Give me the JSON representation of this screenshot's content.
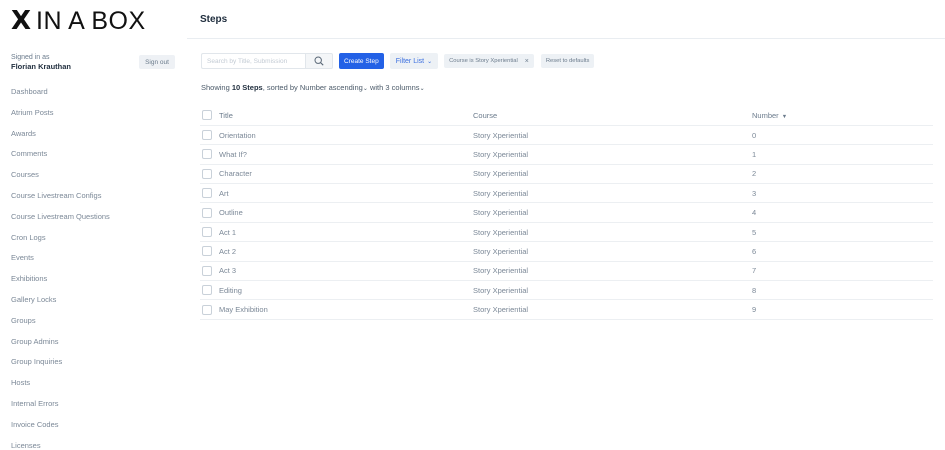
{
  "brand": {
    "mark": "X",
    "text": "IN A BOX"
  },
  "page": {
    "title": "Steps"
  },
  "user": {
    "signed_in_label": "Signed in as",
    "name": "Florian Krauthan",
    "sign_out_label": "Sign out"
  },
  "sidebar": {
    "items": [
      "Dashboard",
      "Atrium Posts",
      "Awards",
      "Comments",
      "Courses",
      "Course Livestream Configs",
      "Course Livestream Questions",
      "Cron Logs",
      "Events",
      "Exhibitions",
      "Gallery Locks",
      "Groups",
      "Group Admins",
      "Group Inquiries",
      "Hosts",
      "Internal Errors",
      "Invoice Codes",
      "Licenses"
    ]
  },
  "toolbar": {
    "search_placeholder": "Search by Title, Submission",
    "search_value": "",
    "create_label": "Create Step",
    "filter_label": "Filter List",
    "active_filter": "Course is Story Xperiential",
    "reset_label": "Reset to defaults"
  },
  "summary": {
    "prefix": "Showing",
    "count_text": "10 Steps",
    "sorted_text": ", sorted by",
    "sort_field": "Number ascending",
    "with_text": "with",
    "columns_text": "3 columns"
  },
  "table": {
    "headers": {
      "title": "Title",
      "course": "Course",
      "number": "Number"
    },
    "rows": [
      {
        "title": "Orientation",
        "course": "Story Xperiential",
        "number": "0"
      },
      {
        "title": "What If?",
        "course": "Story Xperiential",
        "number": "1"
      },
      {
        "title": "Character",
        "course": "Story Xperiential",
        "number": "2"
      },
      {
        "title": "Art",
        "course": "Story Xperiential",
        "number": "3"
      },
      {
        "title": "Outline",
        "course": "Story Xperiential",
        "number": "4"
      },
      {
        "title": "Act 1",
        "course": "Story Xperiential",
        "number": "5"
      },
      {
        "title": "Act 2",
        "course": "Story Xperiential",
        "number": "6"
      },
      {
        "title": "Act 3",
        "course": "Story Xperiential",
        "number": "7"
      },
      {
        "title": "Editing",
        "course": "Story Xperiential",
        "number": "8"
      },
      {
        "title": "May Exhibition",
        "course": "Story Xperiential",
        "number": "9"
      }
    ]
  },
  "icons": {
    "search": "search-icon",
    "filter_chevron": "chevron-down-icon",
    "remove_filter": "close-icon",
    "sort": "sort-descending-icon",
    "checkbox": "checkbox-icon"
  },
  "colors": {
    "primary": "#2361e6",
    "link": "#3b6fe0",
    "text_muted": "#7b8897",
    "button_bg": "#edf1f5"
  }
}
